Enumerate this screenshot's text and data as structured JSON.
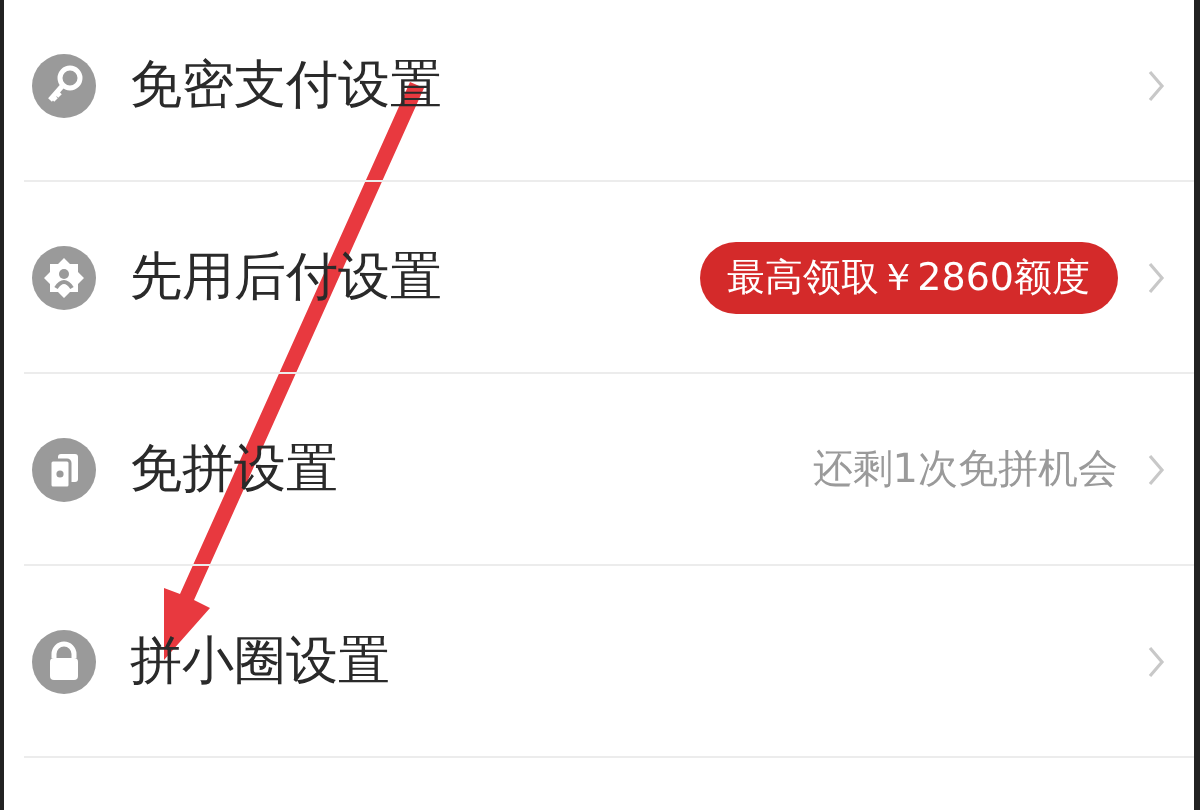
{
  "settings": [
    {
      "label": "免密支付设置"
    },
    {
      "label": "先用后付设置",
      "detail": {
        "kind": "badge",
        "text": "最高领取￥2860额度"
      }
    },
    {
      "label": "免拼设置",
      "detail": {
        "kind": "hint",
        "text": "还剩1次免拼机会"
      }
    },
    {
      "label": "拼小圈设置"
    }
  ]
}
